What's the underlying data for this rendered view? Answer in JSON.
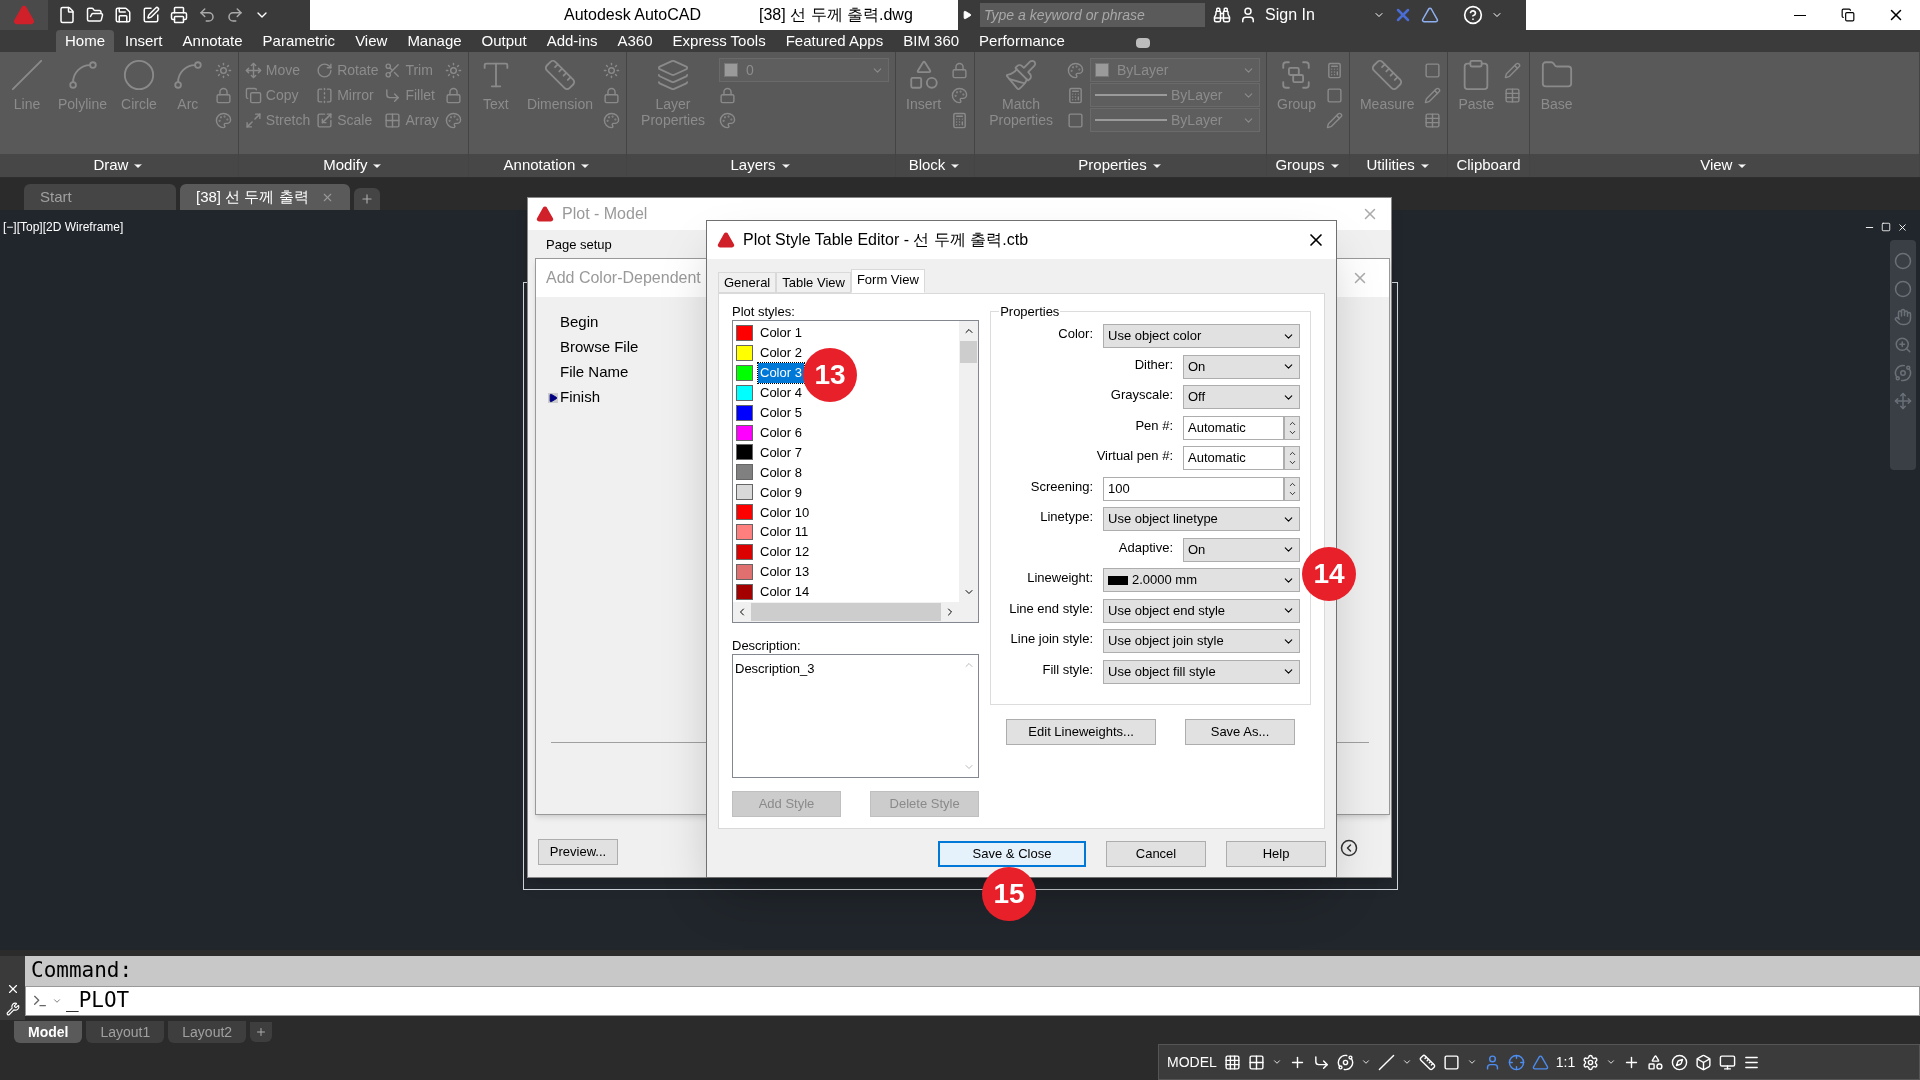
{
  "title_bar": {
    "app": "Autodesk AutoCAD",
    "file": "[38] 선 두께 출력.dwg",
    "search": {
      "placeholder": "Type a keyword or phrase"
    },
    "sign_in": "Sign In"
  },
  "ribbon_tabs": [
    {
      "label": "Home",
      "selected": true
    },
    {
      "label": "Insert",
      "selected": false
    },
    {
      "label": "Annotate",
      "selected": false
    },
    {
      "label": "Parametric",
      "selected": false
    },
    {
      "label": "View",
      "selected": false
    },
    {
      "label": "Manage",
      "selected": false
    },
    {
      "label": "Output",
      "selected": false
    },
    {
      "label": "Add-ins",
      "selected": false
    },
    {
      "label": "A360",
      "selected": false
    },
    {
      "label": "Express Tools",
      "selected": false
    },
    {
      "label": "Featured Apps",
      "selected": false
    },
    {
      "label": "BIM 360",
      "selected": false
    },
    {
      "label": "Performance",
      "selected": false
    }
  ],
  "ribbon_panels": [
    {
      "title": "Draw",
      "has_menu": true,
      "columns": [
        [
          {
            "kind": "large",
            "label": "Line"
          }
        ],
        [
          {
            "kind": "large",
            "label": "Polyline"
          }
        ],
        [
          {
            "kind": "large",
            "label": "Circle"
          }
        ],
        [
          {
            "kind": "large",
            "label": "Arc"
          }
        ],
        [
          {
            "kind": "icon"
          },
          {
            "kind": "icon"
          },
          {
            "kind": "icon"
          }
        ]
      ]
    },
    {
      "title": "Modify",
      "has_menu": true,
      "columns": [
        [
          {
            "kind": "small",
            "label": "Move"
          },
          {
            "kind": "small",
            "label": "Copy"
          },
          {
            "kind": "small",
            "label": "Stretch"
          }
        ],
        [
          {
            "kind": "small",
            "label": "Rotate"
          },
          {
            "kind": "small",
            "label": "Mirror"
          },
          {
            "kind": "small",
            "label": "Scale"
          }
        ],
        [
          {
            "kind": "small",
            "label": "Trim"
          },
          {
            "kind": "small",
            "label": "Fillet"
          },
          {
            "kind": "small",
            "label": "Array"
          }
        ],
        [
          {
            "kind": "icon"
          },
          {
            "kind": "icon"
          },
          {
            "kind": "icon"
          }
        ]
      ]
    },
    {
      "title": "Annotation",
      "has_menu": true,
      "columns": [
        [
          {
            "kind": "large",
            "label": "Text"
          }
        ],
        [
          {
            "kind": "large",
            "label": "Dimension"
          }
        ],
        [
          {
            "kind": "icon"
          },
          {
            "kind": "icon"
          },
          {
            "kind": "icon"
          }
        ]
      ]
    },
    {
      "title": "Layers",
      "has_menu": true,
      "columns": [
        [
          {
            "kind": "large",
            "label": "Layer Properties"
          }
        ],
        [
          {
            "kind": "dropdown",
            "label": "0"
          },
          {
            "kind": "icon"
          },
          {
            "kind": "icon"
          }
        ]
      ]
    },
    {
      "title": "Block",
      "has_menu": true,
      "columns": [
        [
          {
            "kind": "large",
            "label": "Insert"
          }
        ],
        [
          {
            "kind": "icon"
          },
          {
            "kind": "icon"
          },
          {
            "kind": "icon"
          }
        ]
      ]
    },
    {
      "title": "Properties",
      "has_menu": true,
      "columns": [
        [
          {
            "kind": "large",
            "label": "Match Properties"
          }
        ],
        [
          {
            "kind": "icon"
          },
          {
            "kind": "icon"
          },
          {
            "kind": "icon"
          }
        ],
        [
          {
            "kind": "dropdown",
            "label": "ByLayer"
          },
          {
            "kind": "line-dropdown",
            "label": "ByLayer"
          },
          {
            "kind": "line-dropdown",
            "label": "ByLayer"
          }
        ]
      ]
    },
    {
      "title": "Groups",
      "has_menu": true,
      "columns": [
        [
          {
            "kind": "large",
            "label": "Group"
          }
        ],
        [
          {
            "kind": "icon"
          },
          {
            "kind": "icon"
          },
          {
            "kind": "icon"
          }
        ]
      ]
    },
    {
      "title": "Utilities",
      "has_menu": true,
      "columns": [
        [
          {
            "kind": "large",
            "label": "Measure"
          }
        ],
        [
          {
            "kind": "icon"
          },
          {
            "kind": "icon"
          },
          {
            "kind": "icon"
          }
        ]
      ]
    },
    {
      "title": "Clipboard",
      "has_menu": false,
      "columns": [
        [
          {
            "kind": "large",
            "label": "Paste"
          }
        ],
        [
          {
            "kind": "icon"
          },
          {
            "kind": "icon"
          }
        ]
      ]
    },
    {
      "title": "View",
      "has_menu": true,
      "columns": [
        [
          {
            "kind": "large",
            "label": "Base"
          }
        ]
      ]
    }
  ],
  "doc_tabs": [
    {
      "label": "Start",
      "selected": false
    },
    {
      "label": "[38] 선 두께 출력",
      "selected": true
    }
  ],
  "viewport_label": "[−][Top][2D Wireframe]",
  "plot_dialog": {
    "title": "Plot - Model",
    "page_setup": "Page setup",
    "preview_button": "Preview..."
  },
  "wizard": {
    "title": "Add Color-Dependent",
    "steps": [
      {
        "label": "Begin",
        "selected": false
      },
      {
        "label": "Browse File",
        "selected": false
      },
      {
        "label": "File Name",
        "selected": false
      },
      {
        "label": "Finish",
        "selected": true
      }
    ]
  },
  "editor": {
    "title": "Plot Style Table Editor - 선 두께 출력.ctb",
    "tabs": [
      {
        "label": "General",
        "selected": false
      },
      {
        "label": "Table View",
        "selected": false
      },
      {
        "label": "Form View",
        "selected": true
      }
    ],
    "plot_styles_label": "Plot styles:",
    "plot_styles": [
      {
        "label": "Color 1",
        "color": "#ff0000",
        "selected": false
      },
      {
        "label": "Color 2",
        "color": "#ffff00",
        "selected": false
      },
      {
        "label": "Color 3",
        "color": "#00ff00",
        "selected": true
      },
      {
        "label": "Color 4",
        "color": "#00ffff",
        "selected": false
      },
      {
        "label": "Color 5",
        "color": "#0000ff",
        "selected": false
      },
      {
        "label": "Color 6",
        "color": "#ff00ff",
        "selected": false
      },
      {
        "label": "Color 7",
        "color": "#000000",
        "selected": false
      },
      {
        "label": "Color 8",
        "color": "#808080",
        "selected": false
      },
      {
        "label": "Color 9",
        "color": "#d9d9d9",
        "selected": false
      },
      {
        "label": "Color 10",
        "color": "#ff0000",
        "selected": false
      },
      {
        "label": "Color 11",
        "color": "#ff7f7f",
        "selected": false
      },
      {
        "label": "Color 12",
        "color": "#dd0000",
        "selected": false
      },
      {
        "label": "Color 13",
        "color": "#e07070",
        "selected": false
      },
      {
        "label": "Color 14",
        "color": "#a50000",
        "selected": false
      }
    ],
    "description_label": "Description:",
    "description": "Description_3",
    "add_style": "Add Style",
    "delete_style": "Delete Style",
    "properties_label": "Properties",
    "properties": [
      {
        "label": "Color:",
        "kind": "select",
        "value": "Use object color"
      },
      {
        "label": "Dither:",
        "kind": "short-select",
        "value": "On"
      },
      {
        "label": "Grayscale:",
        "kind": "short-select",
        "value": "Off"
      },
      {
        "label": "Pen #:",
        "kind": "short-spin",
        "value": "Automatic"
      },
      {
        "label": "Virtual pen #:",
        "kind": "short-spin",
        "value": "Automatic"
      },
      {
        "label": "Screening:",
        "kind": "spin",
        "value": "100"
      },
      {
        "label": "Linetype:",
        "kind": "select",
        "value": "Use object linetype"
      },
      {
        "label": "Adaptive:",
        "kind": "short-select",
        "value": "On"
      },
      {
        "label": "Lineweight:",
        "kind": "swatch-select",
        "value": "2.0000 mm"
      },
      {
        "label": "Line end style:",
        "kind": "select",
        "value": "Use object end style"
      },
      {
        "label": "Line join style:",
        "kind": "select",
        "value": "Use object join style"
      },
      {
        "label": "Fill style:",
        "kind": "select",
        "value": "Use object fill style"
      }
    ],
    "edit_lineweights": "Edit Lineweights...",
    "save_as": "Save As...",
    "buttons": [
      {
        "label": "Save & Close",
        "default": true
      },
      {
        "label": "Cancel",
        "default": false
      },
      {
        "label": "Help",
        "default": false
      }
    ]
  },
  "callouts": [
    "13",
    "14",
    "15"
  ],
  "command": {
    "history": "Command:",
    "input": "_PLOT"
  },
  "layout_tabs": [
    {
      "label": "Model",
      "selected": true
    },
    {
      "label": "Layout1",
      "selected": false
    },
    {
      "label": "Layout2",
      "selected": false
    }
  ],
  "status_bar": {
    "model": "MODEL",
    "scale": "1:1"
  }
}
